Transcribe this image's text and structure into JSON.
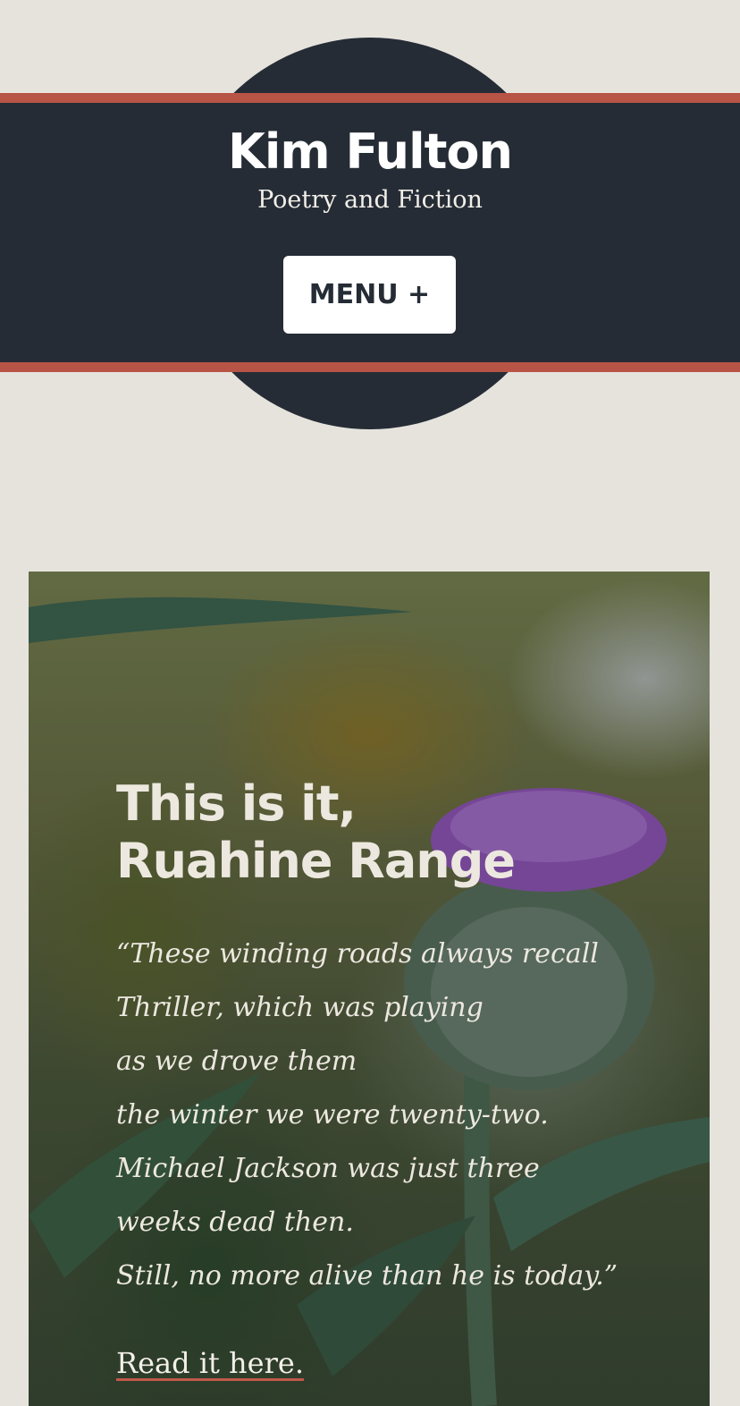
{
  "header": {
    "site_title": "Kim Fulton",
    "tagline": "Poetry and Fiction",
    "menu_label": "MENU +"
  },
  "hero": {
    "title_line_1": "This is it,",
    "title_line_2": "Ruahine Range",
    "excerpt_lines": [
      "“These winding roads always recall",
      "Thriller, which was playing",
      "as we drove them",
      "the winter we were twenty-two.",
      "Michael Jackson was just three",
      "weeks dead then.",
      "Still, no more alive than he is today.”"
    ],
    "link_label": "Read it here."
  },
  "colors": {
    "background": "#e6e3dd",
    "header": "#262c35",
    "accent": "#b85446",
    "menu_button": "#ffffff",
    "hero_text": "#ece8df",
    "thistle_flower": "#9a58c8"
  },
  "icons": {
    "hero_image": "thistle-photo"
  }
}
